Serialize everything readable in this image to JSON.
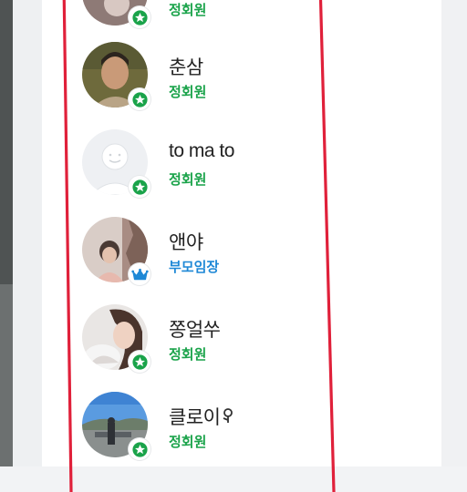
{
  "colors": {
    "regular_role": "#1aa34a",
    "leader_role": "#1e88d6",
    "highlight_border": "#e0203a"
  },
  "members": [
    {
      "nickname": "",
      "role": "정회원",
      "badge": "star-icon"
    },
    {
      "nickname": "춘삼",
      "role": "정회원",
      "badge": "star-icon"
    },
    {
      "nickname": "to ma to",
      "role": "정회원",
      "badge": "star-icon"
    },
    {
      "nickname": "앤야",
      "role": "부모임장",
      "badge": "crown-icon"
    },
    {
      "nickname": "쫑얼쑤",
      "role": "정회원",
      "badge": "star-icon"
    },
    {
      "nickname": "클로이",
      "role": "정회원",
      "badge": "star-icon"
    }
  ]
}
